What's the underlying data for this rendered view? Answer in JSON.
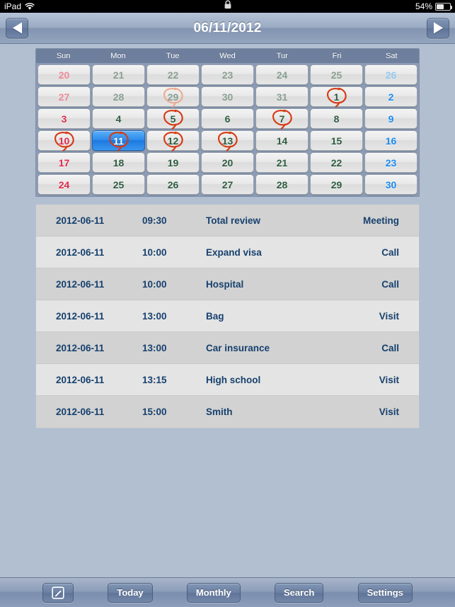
{
  "status_bar": {
    "carrier": "iPad",
    "wifi_icon": "wifi-icon",
    "lock_icon": "rotation-lock-icon",
    "battery_percent": "54%",
    "battery_icon": "battery-icon"
  },
  "nav_bar": {
    "title": "06/11/2012",
    "prev_icon": "triangle-left-icon",
    "next_icon": "triangle-right-icon"
  },
  "calendar": {
    "weekdays": [
      "Sun",
      "Mon",
      "Tue",
      "Wed",
      "Tur",
      "Fri",
      "Sat"
    ],
    "colors": {
      "sunday": "#e12a4b",
      "saturday": "#1b8bf0",
      "weekday": "#2d5b3f",
      "selected_bg": "#2f8ded",
      "circle_mark": "#d63a12",
      "header_bg": "#6d7f9d",
      "page_bg": "#b2bfd1"
    },
    "days": [
      {
        "num": "20",
        "month": "other",
        "col": "sun",
        "marked": false,
        "selected": false
      },
      {
        "num": "21",
        "month": "other",
        "col": "wd",
        "marked": false,
        "selected": false
      },
      {
        "num": "22",
        "month": "other",
        "col": "wd",
        "marked": false,
        "selected": false
      },
      {
        "num": "23",
        "month": "other",
        "col": "wd",
        "marked": false,
        "selected": false
      },
      {
        "num": "24",
        "month": "other",
        "col": "wd",
        "marked": false,
        "selected": false
      },
      {
        "num": "25",
        "month": "other",
        "col": "wd",
        "marked": false,
        "selected": false
      },
      {
        "num": "26",
        "month": "other",
        "col": "sat",
        "marked": false,
        "selected": false
      },
      {
        "num": "27",
        "month": "other",
        "col": "sun",
        "marked": false,
        "selected": false
      },
      {
        "num": "28",
        "month": "other",
        "col": "wd",
        "marked": false,
        "selected": false
      },
      {
        "num": "29",
        "month": "other",
        "col": "wd",
        "marked": true,
        "selected": false
      },
      {
        "num": "30",
        "month": "other",
        "col": "wd",
        "marked": false,
        "selected": false
      },
      {
        "num": "31",
        "month": "other",
        "col": "wd",
        "marked": false,
        "selected": false
      },
      {
        "num": "1",
        "month": "current",
        "col": "wd",
        "marked": true,
        "selected": false
      },
      {
        "num": "2",
        "month": "current",
        "col": "sat",
        "marked": false,
        "selected": false
      },
      {
        "num": "3",
        "month": "current",
        "col": "sun",
        "marked": false,
        "selected": false
      },
      {
        "num": "4",
        "month": "current",
        "col": "wd",
        "marked": false,
        "selected": false
      },
      {
        "num": "5",
        "month": "current",
        "col": "wd",
        "marked": true,
        "selected": false
      },
      {
        "num": "6",
        "month": "current",
        "col": "wd",
        "marked": false,
        "selected": false
      },
      {
        "num": "7",
        "month": "current",
        "col": "wd",
        "marked": true,
        "selected": false
      },
      {
        "num": "8",
        "month": "current",
        "col": "wd",
        "marked": false,
        "selected": false
      },
      {
        "num": "9",
        "month": "current",
        "col": "sat",
        "marked": false,
        "selected": false
      },
      {
        "num": "10",
        "month": "current",
        "col": "sun",
        "marked": true,
        "selected": false
      },
      {
        "num": "11",
        "month": "current",
        "col": "wd",
        "marked": true,
        "selected": true
      },
      {
        "num": "12",
        "month": "current",
        "col": "wd",
        "marked": true,
        "selected": false
      },
      {
        "num": "13",
        "month": "current",
        "col": "wd",
        "marked": true,
        "selected": false
      },
      {
        "num": "14",
        "month": "current",
        "col": "wd",
        "marked": false,
        "selected": false
      },
      {
        "num": "15",
        "month": "current",
        "col": "wd",
        "marked": false,
        "selected": false
      },
      {
        "num": "16",
        "month": "current",
        "col": "sat",
        "marked": false,
        "selected": false
      },
      {
        "num": "17",
        "month": "current",
        "col": "sun",
        "marked": false,
        "selected": false
      },
      {
        "num": "18",
        "month": "current",
        "col": "wd",
        "marked": false,
        "selected": false
      },
      {
        "num": "19",
        "month": "current",
        "col": "wd",
        "marked": false,
        "selected": false
      },
      {
        "num": "20",
        "month": "current",
        "col": "wd",
        "marked": false,
        "selected": false
      },
      {
        "num": "21",
        "month": "current",
        "col": "wd",
        "marked": false,
        "selected": false
      },
      {
        "num": "22",
        "month": "current",
        "col": "wd",
        "marked": false,
        "selected": false
      },
      {
        "num": "23",
        "month": "current",
        "col": "sat",
        "marked": false,
        "selected": false
      },
      {
        "num": "24",
        "month": "current",
        "col": "sun",
        "marked": false,
        "selected": false
      },
      {
        "num": "25",
        "month": "current",
        "col": "wd",
        "marked": false,
        "selected": false
      },
      {
        "num": "26",
        "month": "current",
        "col": "wd",
        "marked": false,
        "selected": false
      },
      {
        "num": "27",
        "month": "current",
        "col": "wd",
        "marked": false,
        "selected": false
      },
      {
        "num": "28",
        "month": "current",
        "col": "wd",
        "marked": false,
        "selected": false
      },
      {
        "num": "29",
        "month": "current",
        "col": "wd",
        "marked": false,
        "selected": false
      },
      {
        "num": "30",
        "month": "current",
        "col": "sat",
        "marked": false,
        "selected": false
      }
    ]
  },
  "events": [
    {
      "date": "2012-06-11",
      "time": "09:30",
      "title": "Total review",
      "type": "Meeting"
    },
    {
      "date": "2012-06-11",
      "time": "10:00",
      "title": "Expand visa",
      "type": "Call"
    },
    {
      "date": "2012-06-11",
      "time": "10:00",
      "title": "Hospital",
      "type": "Call"
    },
    {
      "date": "2012-06-11",
      "time": "13:00",
      "title": "Bag",
      "type": "Visit"
    },
    {
      "date": "2012-06-11",
      "time": "13:00",
      "title": "Car insurance",
      "type": "Call"
    },
    {
      "date": "2012-06-11",
      "time": "13:15",
      "title": "High school",
      "type": "Visit"
    },
    {
      "date": "2012-06-11",
      "time": "15:00",
      "title": "Smith",
      "type": "Visit"
    }
  ],
  "toolbar": {
    "compose_icon": "compose-icon",
    "buttons": [
      "Today",
      "Monthly",
      "Search",
      "Settings"
    ]
  }
}
